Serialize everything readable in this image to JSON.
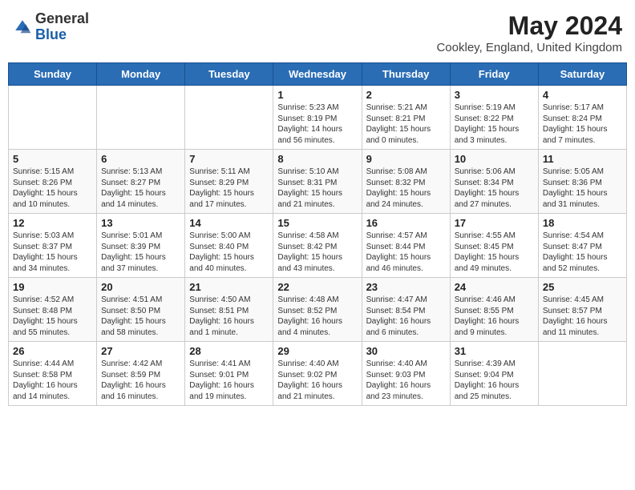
{
  "header": {
    "logo_line1": "General",
    "logo_line2": "Blue",
    "month_title": "May 2024",
    "location": "Cookley, England, United Kingdom"
  },
  "weekdays": [
    "Sunday",
    "Monday",
    "Tuesday",
    "Wednesday",
    "Thursday",
    "Friday",
    "Saturday"
  ],
  "weeks": [
    [
      {
        "day": "",
        "sunrise": "",
        "sunset": "",
        "daylight": ""
      },
      {
        "day": "",
        "sunrise": "",
        "sunset": "",
        "daylight": ""
      },
      {
        "day": "",
        "sunrise": "",
        "sunset": "",
        "daylight": ""
      },
      {
        "day": "1",
        "sunrise": "Sunrise: 5:23 AM",
        "sunset": "Sunset: 8:19 PM",
        "daylight": "Daylight: 14 hours and 56 minutes."
      },
      {
        "day": "2",
        "sunrise": "Sunrise: 5:21 AM",
        "sunset": "Sunset: 8:21 PM",
        "daylight": "Daylight: 15 hours and 0 minutes."
      },
      {
        "day": "3",
        "sunrise": "Sunrise: 5:19 AM",
        "sunset": "Sunset: 8:22 PM",
        "daylight": "Daylight: 15 hours and 3 minutes."
      },
      {
        "day": "4",
        "sunrise": "Sunrise: 5:17 AM",
        "sunset": "Sunset: 8:24 PM",
        "daylight": "Daylight: 15 hours and 7 minutes."
      }
    ],
    [
      {
        "day": "5",
        "sunrise": "Sunrise: 5:15 AM",
        "sunset": "Sunset: 8:26 PM",
        "daylight": "Daylight: 15 hours and 10 minutes."
      },
      {
        "day": "6",
        "sunrise": "Sunrise: 5:13 AM",
        "sunset": "Sunset: 8:27 PM",
        "daylight": "Daylight: 15 hours and 14 minutes."
      },
      {
        "day": "7",
        "sunrise": "Sunrise: 5:11 AM",
        "sunset": "Sunset: 8:29 PM",
        "daylight": "Daylight: 15 hours and 17 minutes."
      },
      {
        "day": "8",
        "sunrise": "Sunrise: 5:10 AM",
        "sunset": "Sunset: 8:31 PM",
        "daylight": "Daylight: 15 hours and 21 minutes."
      },
      {
        "day": "9",
        "sunrise": "Sunrise: 5:08 AM",
        "sunset": "Sunset: 8:32 PM",
        "daylight": "Daylight: 15 hours and 24 minutes."
      },
      {
        "day": "10",
        "sunrise": "Sunrise: 5:06 AM",
        "sunset": "Sunset: 8:34 PM",
        "daylight": "Daylight: 15 hours and 27 minutes."
      },
      {
        "day": "11",
        "sunrise": "Sunrise: 5:05 AM",
        "sunset": "Sunset: 8:36 PM",
        "daylight": "Daylight: 15 hours and 31 minutes."
      }
    ],
    [
      {
        "day": "12",
        "sunrise": "Sunrise: 5:03 AM",
        "sunset": "Sunset: 8:37 PM",
        "daylight": "Daylight: 15 hours and 34 minutes."
      },
      {
        "day": "13",
        "sunrise": "Sunrise: 5:01 AM",
        "sunset": "Sunset: 8:39 PM",
        "daylight": "Daylight: 15 hours and 37 minutes."
      },
      {
        "day": "14",
        "sunrise": "Sunrise: 5:00 AM",
        "sunset": "Sunset: 8:40 PM",
        "daylight": "Daylight: 15 hours and 40 minutes."
      },
      {
        "day": "15",
        "sunrise": "Sunrise: 4:58 AM",
        "sunset": "Sunset: 8:42 PM",
        "daylight": "Daylight: 15 hours and 43 minutes."
      },
      {
        "day": "16",
        "sunrise": "Sunrise: 4:57 AM",
        "sunset": "Sunset: 8:44 PM",
        "daylight": "Daylight: 15 hours and 46 minutes."
      },
      {
        "day": "17",
        "sunrise": "Sunrise: 4:55 AM",
        "sunset": "Sunset: 8:45 PM",
        "daylight": "Daylight: 15 hours and 49 minutes."
      },
      {
        "day": "18",
        "sunrise": "Sunrise: 4:54 AM",
        "sunset": "Sunset: 8:47 PM",
        "daylight": "Daylight: 15 hours and 52 minutes."
      }
    ],
    [
      {
        "day": "19",
        "sunrise": "Sunrise: 4:52 AM",
        "sunset": "Sunset: 8:48 PM",
        "daylight": "Daylight: 15 hours and 55 minutes."
      },
      {
        "day": "20",
        "sunrise": "Sunrise: 4:51 AM",
        "sunset": "Sunset: 8:50 PM",
        "daylight": "Daylight: 15 hours and 58 minutes."
      },
      {
        "day": "21",
        "sunrise": "Sunrise: 4:50 AM",
        "sunset": "Sunset: 8:51 PM",
        "daylight": "Daylight: 16 hours and 1 minute."
      },
      {
        "day": "22",
        "sunrise": "Sunrise: 4:48 AM",
        "sunset": "Sunset: 8:52 PM",
        "daylight": "Daylight: 16 hours and 4 minutes."
      },
      {
        "day": "23",
        "sunrise": "Sunrise: 4:47 AM",
        "sunset": "Sunset: 8:54 PM",
        "daylight": "Daylight: 16 hours and 6 minutes."
      },
      {
        "day": "24",
        "sunrise": "Sunrise: 4:46 AM",
        "sunset": "Sunset: 8:55 PM",
        "daylight": "Daylight: 16 hours and 9 minutes."
      },
      {
        "day": "25",
        "sunrise": "Sunrise: 4:45 AM",
        "sunset": "Sunset: 8:57 PM",
        "daylight": "Daylight: 16 hours and 11 minutes."
      }
    ],
    [
      {
        "day": "26",
        "sunrise": "Sunrise: 4:44 AM",
        "sunset": "Sunset: 8:58 PM",
        "daylight": "Daylight: 16 hours and 14 minutes."
      },
      {
        "day": "27",
        "sunrise": "Sunrise: 4:42 AM",
        "sunset": "Sunset: 8:59 PM",
        "daylight": "Daylight: 16 hours and 16 minutes."
      },
      {
        "day": "28",
        "sunrise": "Sunrise: 4:41 AM",
        "sunset": "Sunset: 9:01 PM",
        "daylight": "Daylight: 16 hours and 19 minutes."
      },
      {
        "day": "29",
        "sunrise": "Sunrise: 4:40 AM",
        "sunset": "Sunset: 9:02 PM",
        "daylight": "Daylight: 16 hours and 21 minutes."
      },
      {
        "day": "30",
        "sunrise": "Sunrise: 4:40 AM",
        "sunset": "Sunset: 9:03 PM",
        "daylight": "Daylight: 16 hours and 23 minutes."
      },
      {
        "day": "31",
        "sunrise": "Sunrise: 4:39 AM",
        "sunset": "Sunset: 9:04 PM",
        "daylight": "Daylight: 16 hours and 25 minutes."
      },
      {
        "day": "",
        "sunrise": "",
        "sunset": "",
        "daylight": ""
      }
    ]
  ]
}
